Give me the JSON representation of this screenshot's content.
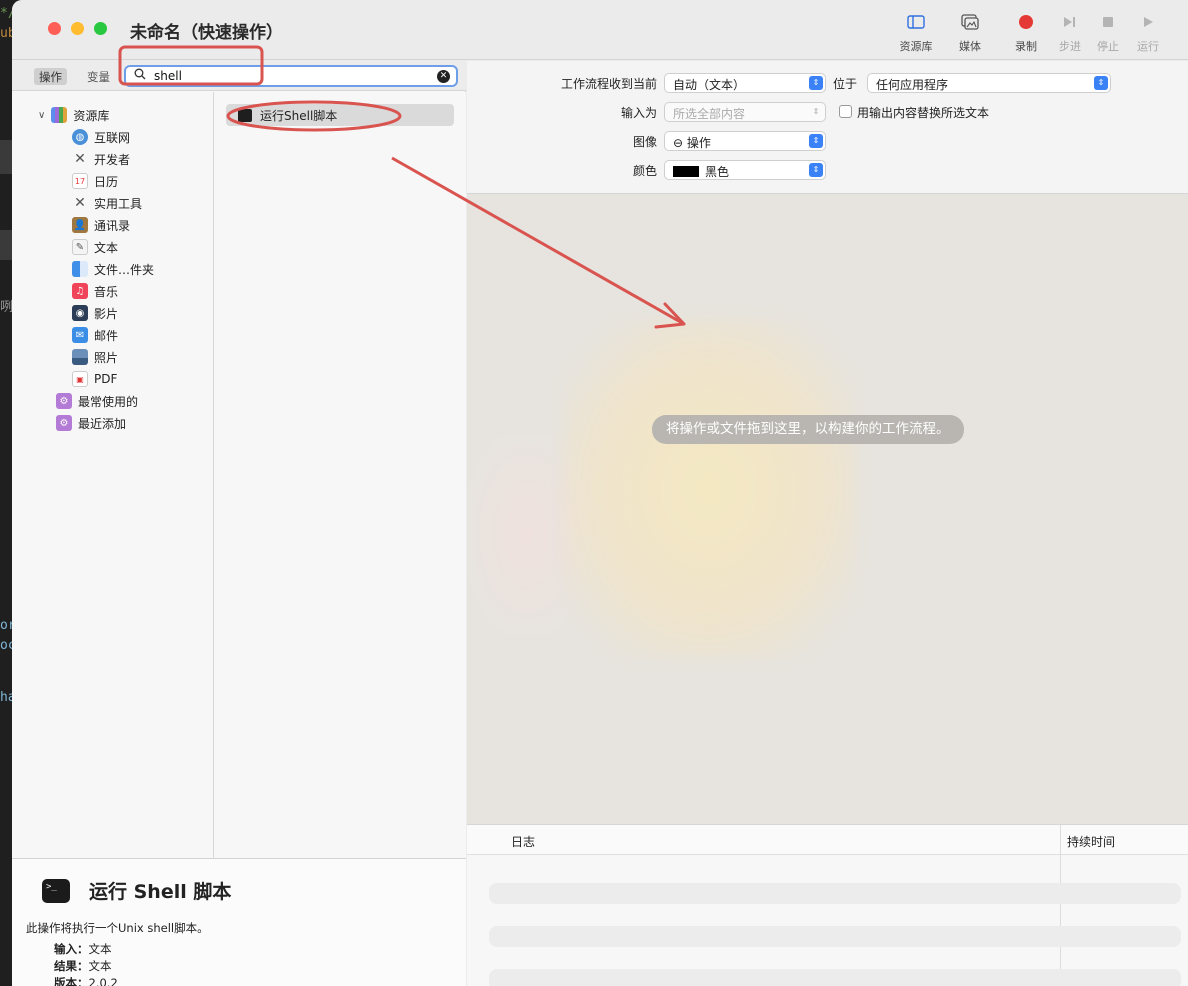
{
  "window": {
    "title": "未命名（快速操作）"
  },
  "toolbar": {
    "library": "资源库",
    "media": "媒体",
    "record": "录制",
    "step": "步进",
    "stop": "停止",
    "run": "运行",
    "record_color": "#e53935"
  },
  "search": {
    "tab_actions": "操作",
    "tab_variables": "变量",
    "value": "shell"
  },
  "library": {
    "root": "资源库",
    "items": [
      {
        "label": "互联网",
        "icon": "globe-icon"
      },
      {
        "label": "开发者",
        "icon": "developer-tools-icon"
      },
      {
        "label": "日历",
        "icon": "calendar-icon"
      },
      {
        "label": "实用工具",
        "icon": "utilities-icon"
      },
      {
        "label": "通讯录",
        "icon": "contacts-icon"
      },
      {
        "label": "文本",
        "icon": "text-icon"
      },
      {
        "label": "文件…件夹",
        "icon": "finder-icon"
      },
      {
        "label": "音乐",
        "icon": "music-icon"
      },
      {
        "label": "影片",
        "icon": "movie-icon"
      },
      {
        "label": "邮件",
        "icon": "mail-icon"
      },
      {
        "label": "照片",
        "icon": "photos-icon"
      },
      {
        "label": "PDF",
        "icon": "pdf-icon"
      }
    ],
    "smart_groups": [
      {
        "label": "最常使用的",
        "icon": "folder-icon"
      },
      {
        "label": "最近添加",
        "icon": "folder-icon"
      }
    ]
  },
  "results": [
    {
      "label": "运行Shell脚本",
      "icon": "terminal-icon"
    }
  ],
  "description": {
    "title": "运行 Shell 脚本",
    "text": "此操作将执行一个Unix shell脚本。",
    "input_label": "输入：",
    "input_value": "文本",
    "result_label": "结果：",
    "result_value": "文本",
    "version_label": "版本：",
    "version_value": "2.0.2"
  },
  "settings": {
    "receives_label": "工作流程收到当前",
    "receives_value": "自动（文本）",
    "in_label": "位于",
    "in_value": "任何应用程序",
    "input_is_label": "输入为",
    "input_is_value": "所选全部内容",
    "replace_label": "用输出内容替换所选文本",
    "image_label": "图像",
    "image_value": "⊖ 操作",
    "color_label": "颜色",
    "color_value": "黑色",
    "color_swatch": "#000000"
  },
  "canvas": {
    "hint": "将操作或文件拖到这里，以构建你的工作流程。"
  },
  "log": {
    "col_log": "日志",
    "col_duration": "持续时间"
  },
  "annotations": {
    "color": "#d9534f"
  }
}
